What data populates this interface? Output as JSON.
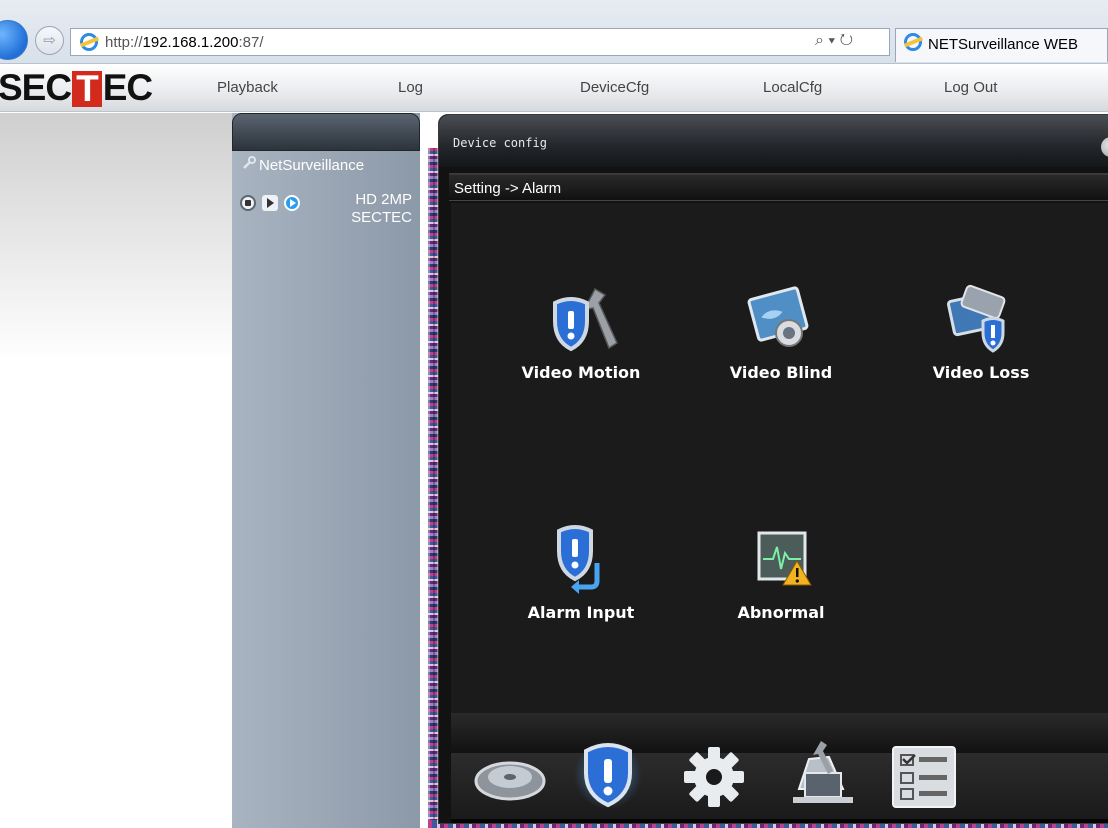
{
  "browser": {
    "url_prefix": "http://",
    "url_host": "192.168.1.200",
    "url_suffix": ":87/",
    "search_refresh": "⌕ ▾ ↻",
    "tab_title": "NETSurveillance WEB"
  },
  "app": {
    "logo_left": "SEC",
    "logo_mark": "T",
    "logo_right": "EC",
    "nav": [
      {
        "label": "Playback"
      },
      {
        "label": "Log"
      },
      {
        "label": "DeviceCfg"
      },
      {
        "label": "LocalCfg"
      },
      {
        "label": "Log Out"
      }
    ]
  },
  "sidebar": {
    "root_label": "NetSurveillance",
    "channel_line1": "HD 2MP",
    "channel_line2": "SECTEC"
  },
  "dialog": {
    "title": "Device config",
    "breadcrumb": "Setting -> Alarm",
    "tiles": [
      {
        "label": "Video Motion",
        "icon": "shield-wrench-icon"
      },
      {
        "label": "Video Blind",
        "icon": "blind-camera-icon"
      },
      {
        "label": "Video Loss",
        "icon": "video-loss-icon"
      },
      {
        "label": "Alarm Input",
        "icon": "shield-arrow-icon"
      },
      {
        "label": "Abnormal",
        "icon": "abnormal-warning-icon"
      }
    ],
    "dock": [
      {
        "icon": "storage-disk-icon"
      },
      {
        "icon": "alarm-shield-icon",
        "active": true
      },
      {
        "icon": "gear-icon"
      },
      {
        "icon": "system-tools-icon"
      },
      {
        "icon": "info-checklist-icon"
      }
    ]
  },
  "colors": {
    "accent_blue": "#2b6fd6",
    "logo_red": "#d32a1e",
    "dialog_bg": "#1b1b1b"
  }
}
